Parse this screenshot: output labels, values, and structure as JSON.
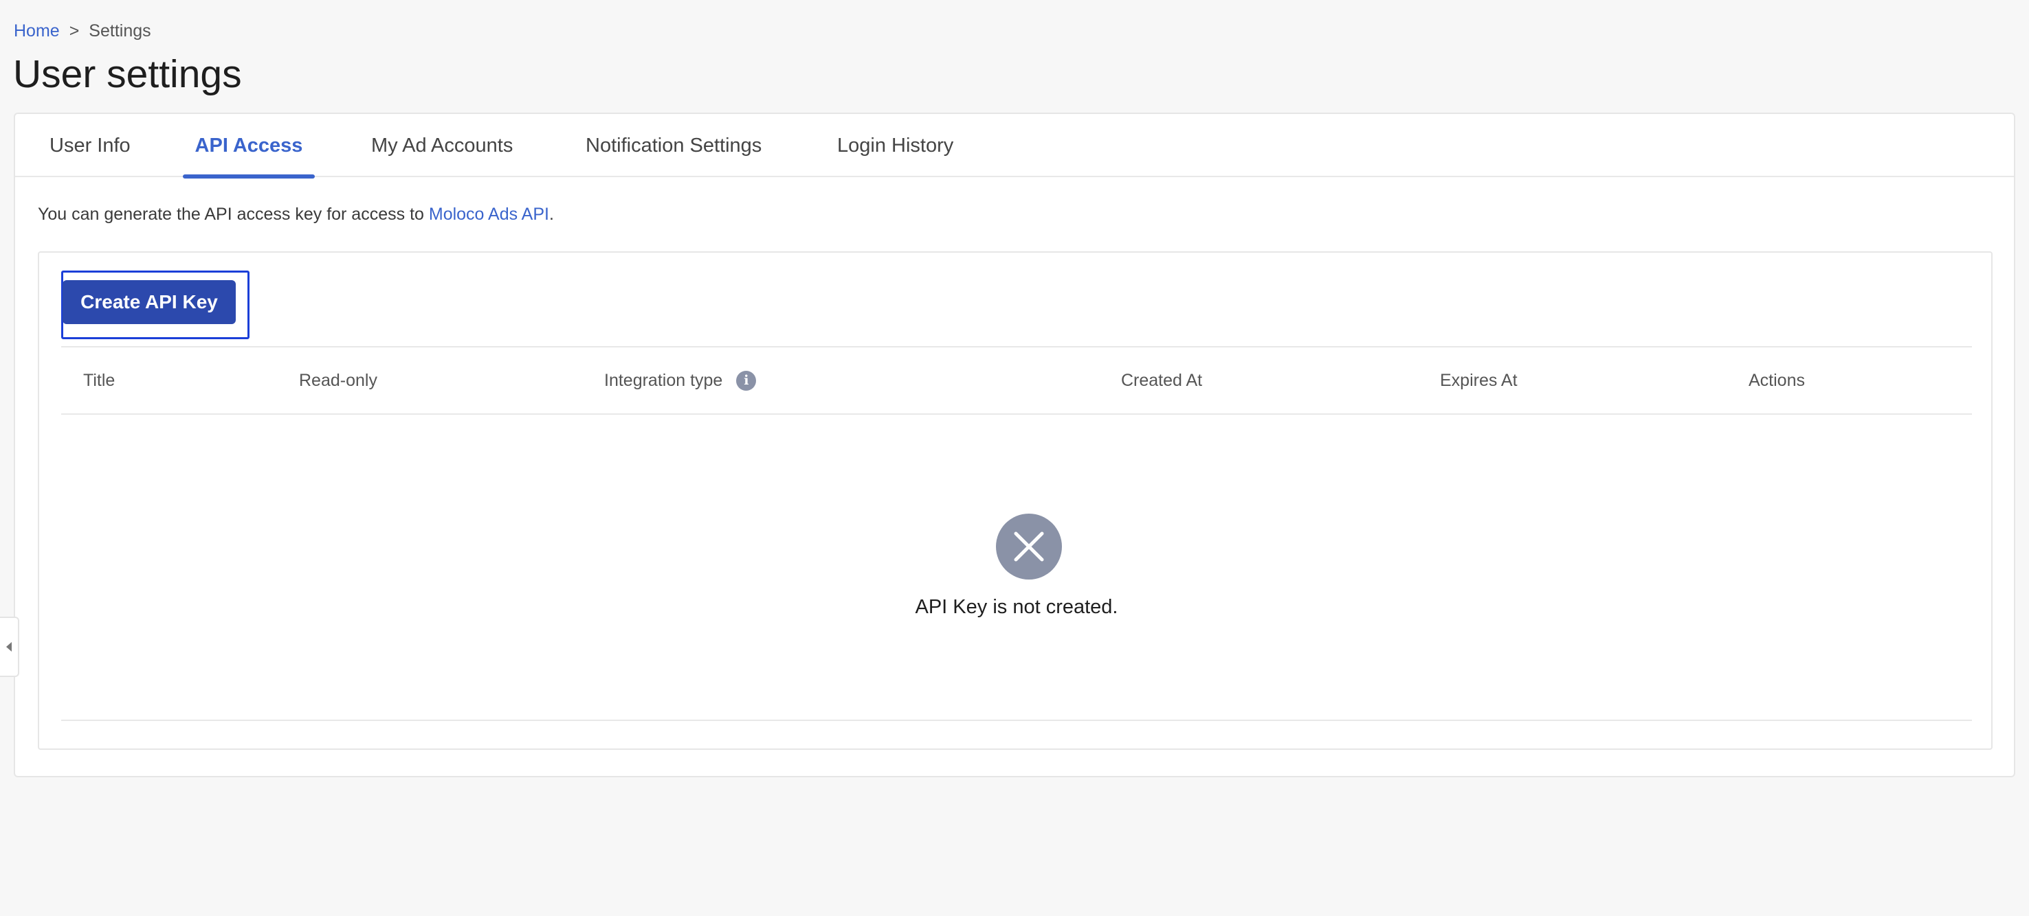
{
  "breadcrumb": {
    "home": "Home",
    "separator": ">",
    "current": "Settings"
  },
  "page": {
    "title": "User settings"
  },
  "tabs": [
    {
      "label": "User Info"
    },
    {
      "label": "API Access",
      "active": true
    },
    {
      "label": "My Ad Accounts"
    },
    {
      "label": "Notification Settings"
    },
    {
      "label": "Login History"
    }
  ],
  "api_access": {
    "description_prefix": "You can generate the API access key for access to ",
    "description_link": "Moloco Ads API",
    "description_suffix": ".",
    "create_button": "Create API Key",
    "table": {
      "columns": [
        "Title",
        "Read-only",
        "Integration type",
        "Created At",
        "Expires At",
        "Actions"
      ]
    },
    "empty_message": "API Key is not created."
  },
  "icons": {
    "info": "info-icon",
    "empty": "close-circle-icon",
    "sidebar_toggle": "chevron-left-icon"
  },
  "colors": {
    "accent": "#3a64cc",
    "button": "#2c49ad",
    "focus_outline": "#1b3fd8",
    "muted_icon": "#8a92a7"
  }
}
